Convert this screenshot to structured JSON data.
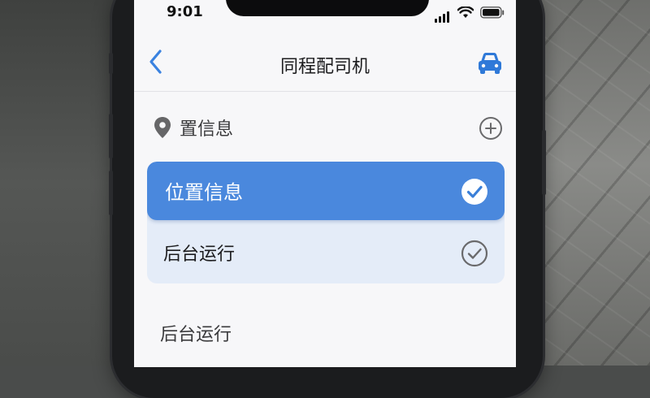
{
  "status_bar": {
    "time": "9:01"
  },
  "nav": {
    "title": "同程配司机",
    "back_icon": "chevron-left-icon",
    "action_icon": "car-icon"
  },
  "location_row": {
    "label": "置信息",
    "icon": "location-pin-icon",
    "action_icon": "add-circle-icon"
  },
  "options": [
    {
      "label": "位置信息",
      "selected": true
    },
    {
      "label": "后台运行",
      "selected": false
    }
  ],
  "footer": {
    "label": "后台运行"
  },
  "colors": {
    "accent": "#4a88dd",
    "option_bg": "#e4ecf8",
    "screen_bg": "#f7f7f9"
  }
}
